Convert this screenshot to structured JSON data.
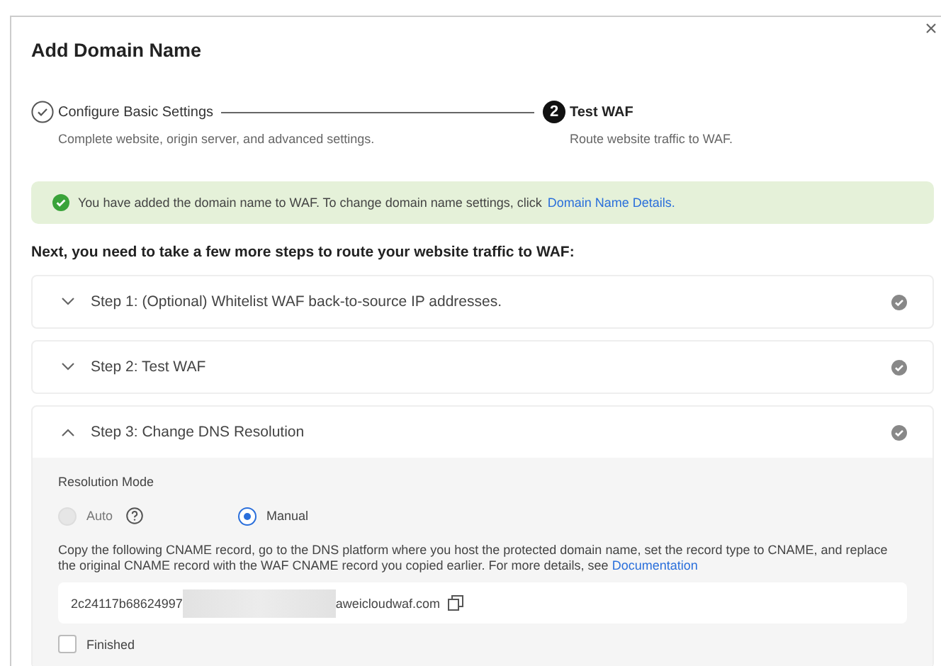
{
  "dialog": {
    "title": "Add Domain Name"
  },
  "steps": [
    {
      "title": "Configure Basic Settings",
      "description": "Complete website, origin server, and advanced settings.",
      "done": true
    },
    {
      "number": "2",
      "title": "Test WAF",
      "description": "Route website traffic to WAF.",
      "done": false
    }
  ],
  "alert": {
    "text": "You have added the domain name to WAF. To change domain name settings, click",
    "link": "Domain Name Details."
  },
  "heading": "Next, you need to take a few more steps to route your website traffic to WAF:",
  "panels": [
    {
      "title": "Step 1: (Optional) Whitelist WAF back-to-source IP addresses.",
      "expanded": false
    },
    {
      "title": "Step 2: Test WAF",
      "expanded": false
    },
    {
      "title": "Step 3: Change DNS Resolution",
      "expanded": true
    }
  ],
  "resolution": {
    "label": "Resolution Mode",
    "options": [
      {
        "label": "Auto",
        "selected": false,
        "disabled": true,
        "help": true
      },
      {
        "label": "Manual",
        "selected": true,
        "disabled": false,
        "help": false
      }
    ],
    "instructions": "Copy the following CNAME record, go to the DNS platform where you host the protected domain name, set the record type to CNAME, and replace the original CNAME record with the WAF CNAME record you copied earlier. For more details, see",
    "link": "Documentation",
    "cname_prefix": "2c24117b68624997",
    "cname_suffix": "aweicloudwaf.com",
    "finished": {
      "label": "Finished",
      "checked": false
    }
  }
}
